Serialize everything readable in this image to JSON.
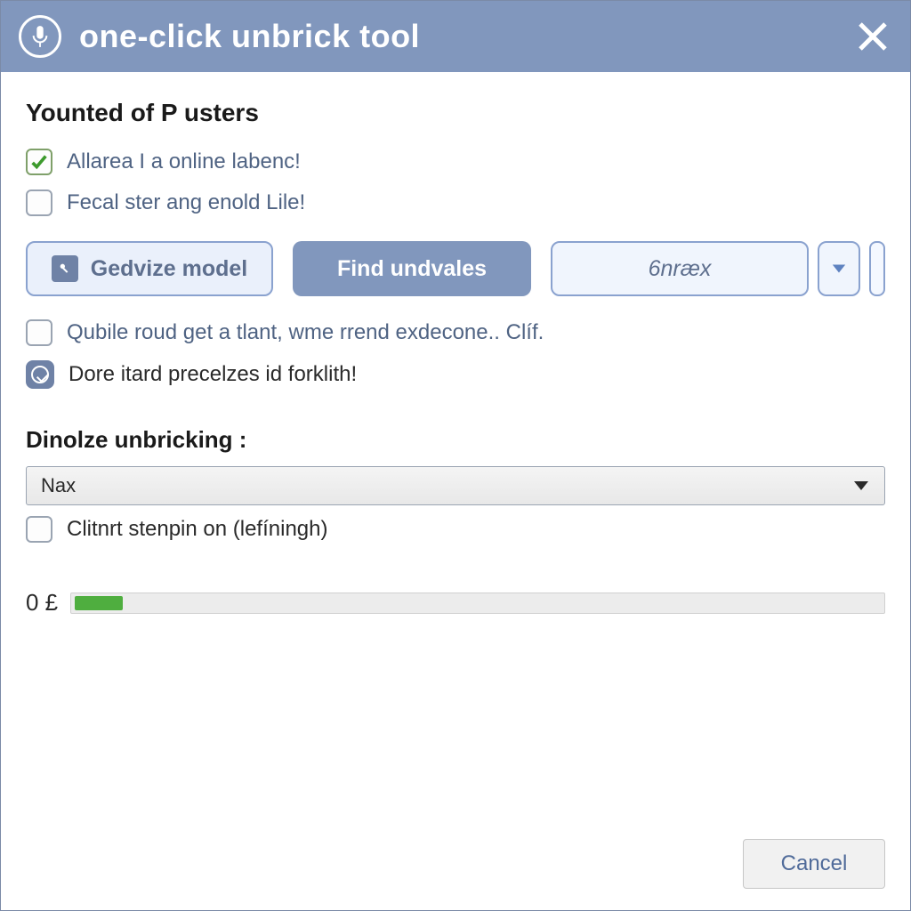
{
  "titlebar": {
    "title": "one-click unbrick tool"
  },
  "section1": {
    "heading": "Younted of P usters",
    "check1_label": "Allarea I a online labenc!",
    "check2_label": "Fecal ster ang enold Lile!"
  },
  "buttons": {
    "devize_label": "Gedvize model",
    "find_label": "Find undvales",
    "select_label": "6nræx"
  },
  "options": {
    "opt1_label": "Qubile roud get a tlant, wme rrend exdecone.. Clíf.",
    "opt2_label": "Dore itard precelzes id forklith!"
  },
  "section2": {
    "heading": "Dinolze unbricking :",
    "dropdown_value": "Nax",
    "check_label": "Clitnrt stenpin on (lefíningh)"
  },
  "progress": {
    "label": "0 £",
    "percent": 6
  },
  "footer": {
    "cancel_label": "Cancel"
  }
}
